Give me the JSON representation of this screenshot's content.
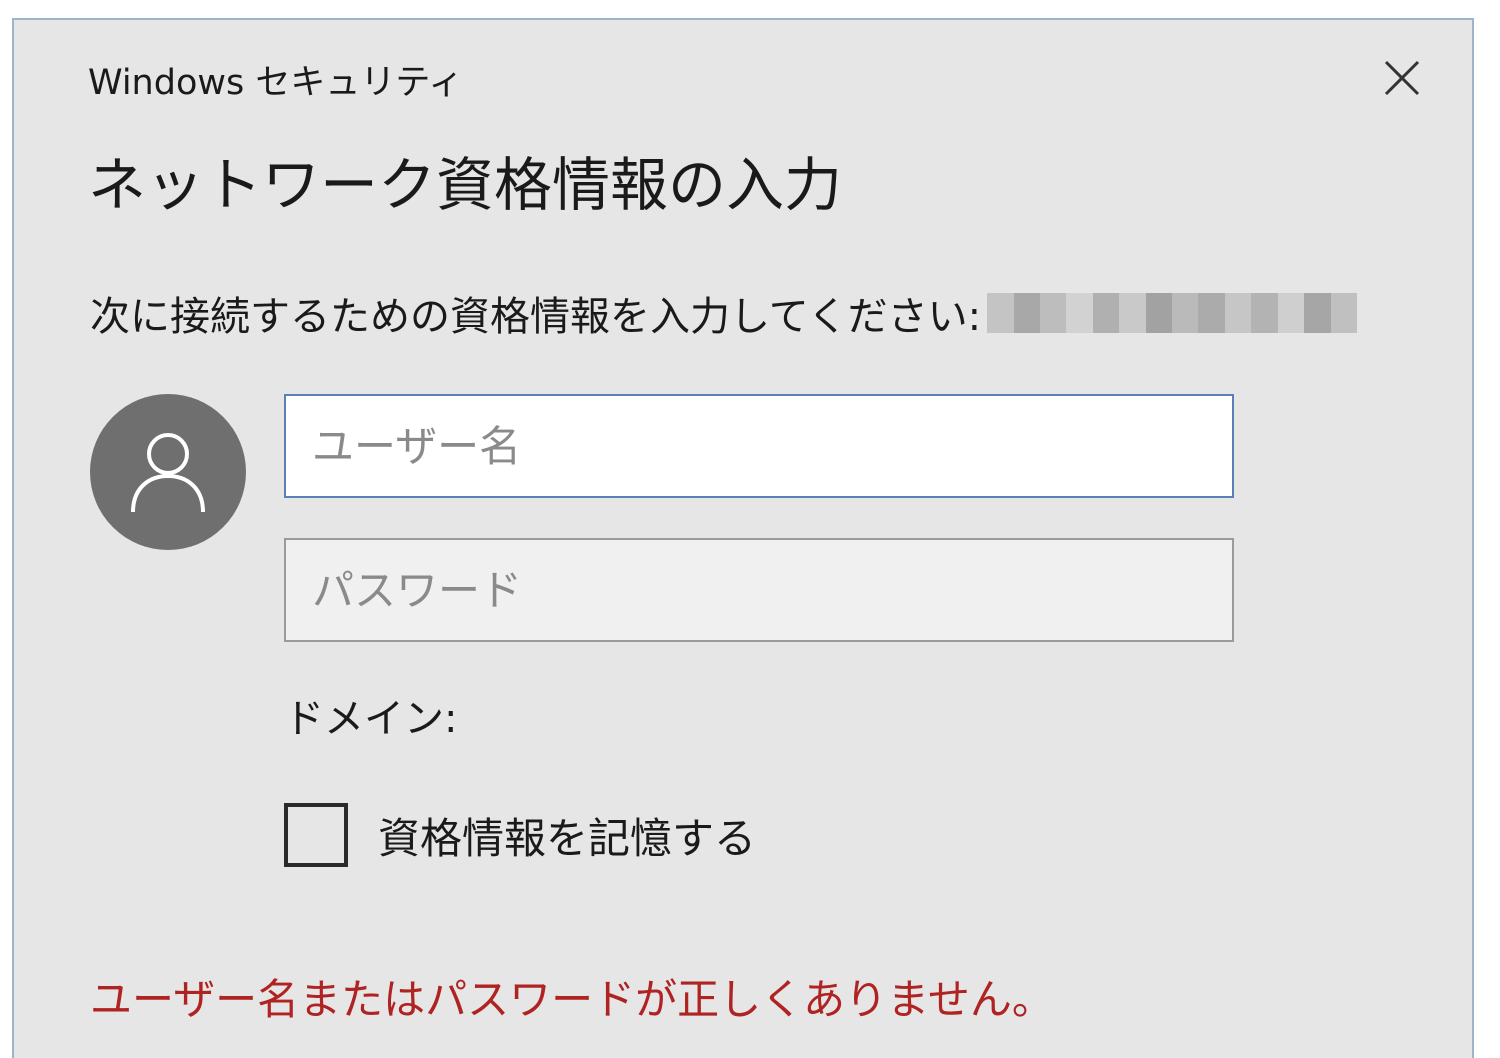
{
  "window": {
    "title": "Windows セキュリティ",
    "close_icon": "close-icon"
  },
  "dialog": {
    "heading": "ネットワーク資格情報の入力",
    "prompt": "次に接続するための資格情報を入力してください:",
    "avatar_icon": "user-icon"
  },
  "form": {
    "username": {
      "placeholder": "ユーザー名",
      "value": ""
    },
    "password": {
      "placeholder": "パスワード",
      "value": ""
    },
    "domain_label": "ドメイン:",
    "remember": {
      "label": "資格情報を記憶する",
      "checked": false
    }
  },
  "error": {
    "message": "ユーザー名またはパスワードが正しくありません。"
  },
  "colors": {
    "dialog_background": "#e6e6e6",
    "window_border": "#9fb4cc",
    "focus_border": "#5a80b8",
    "avatar_background": "#6f6f6f",
    "error_text": "#b02323"
  }
}
